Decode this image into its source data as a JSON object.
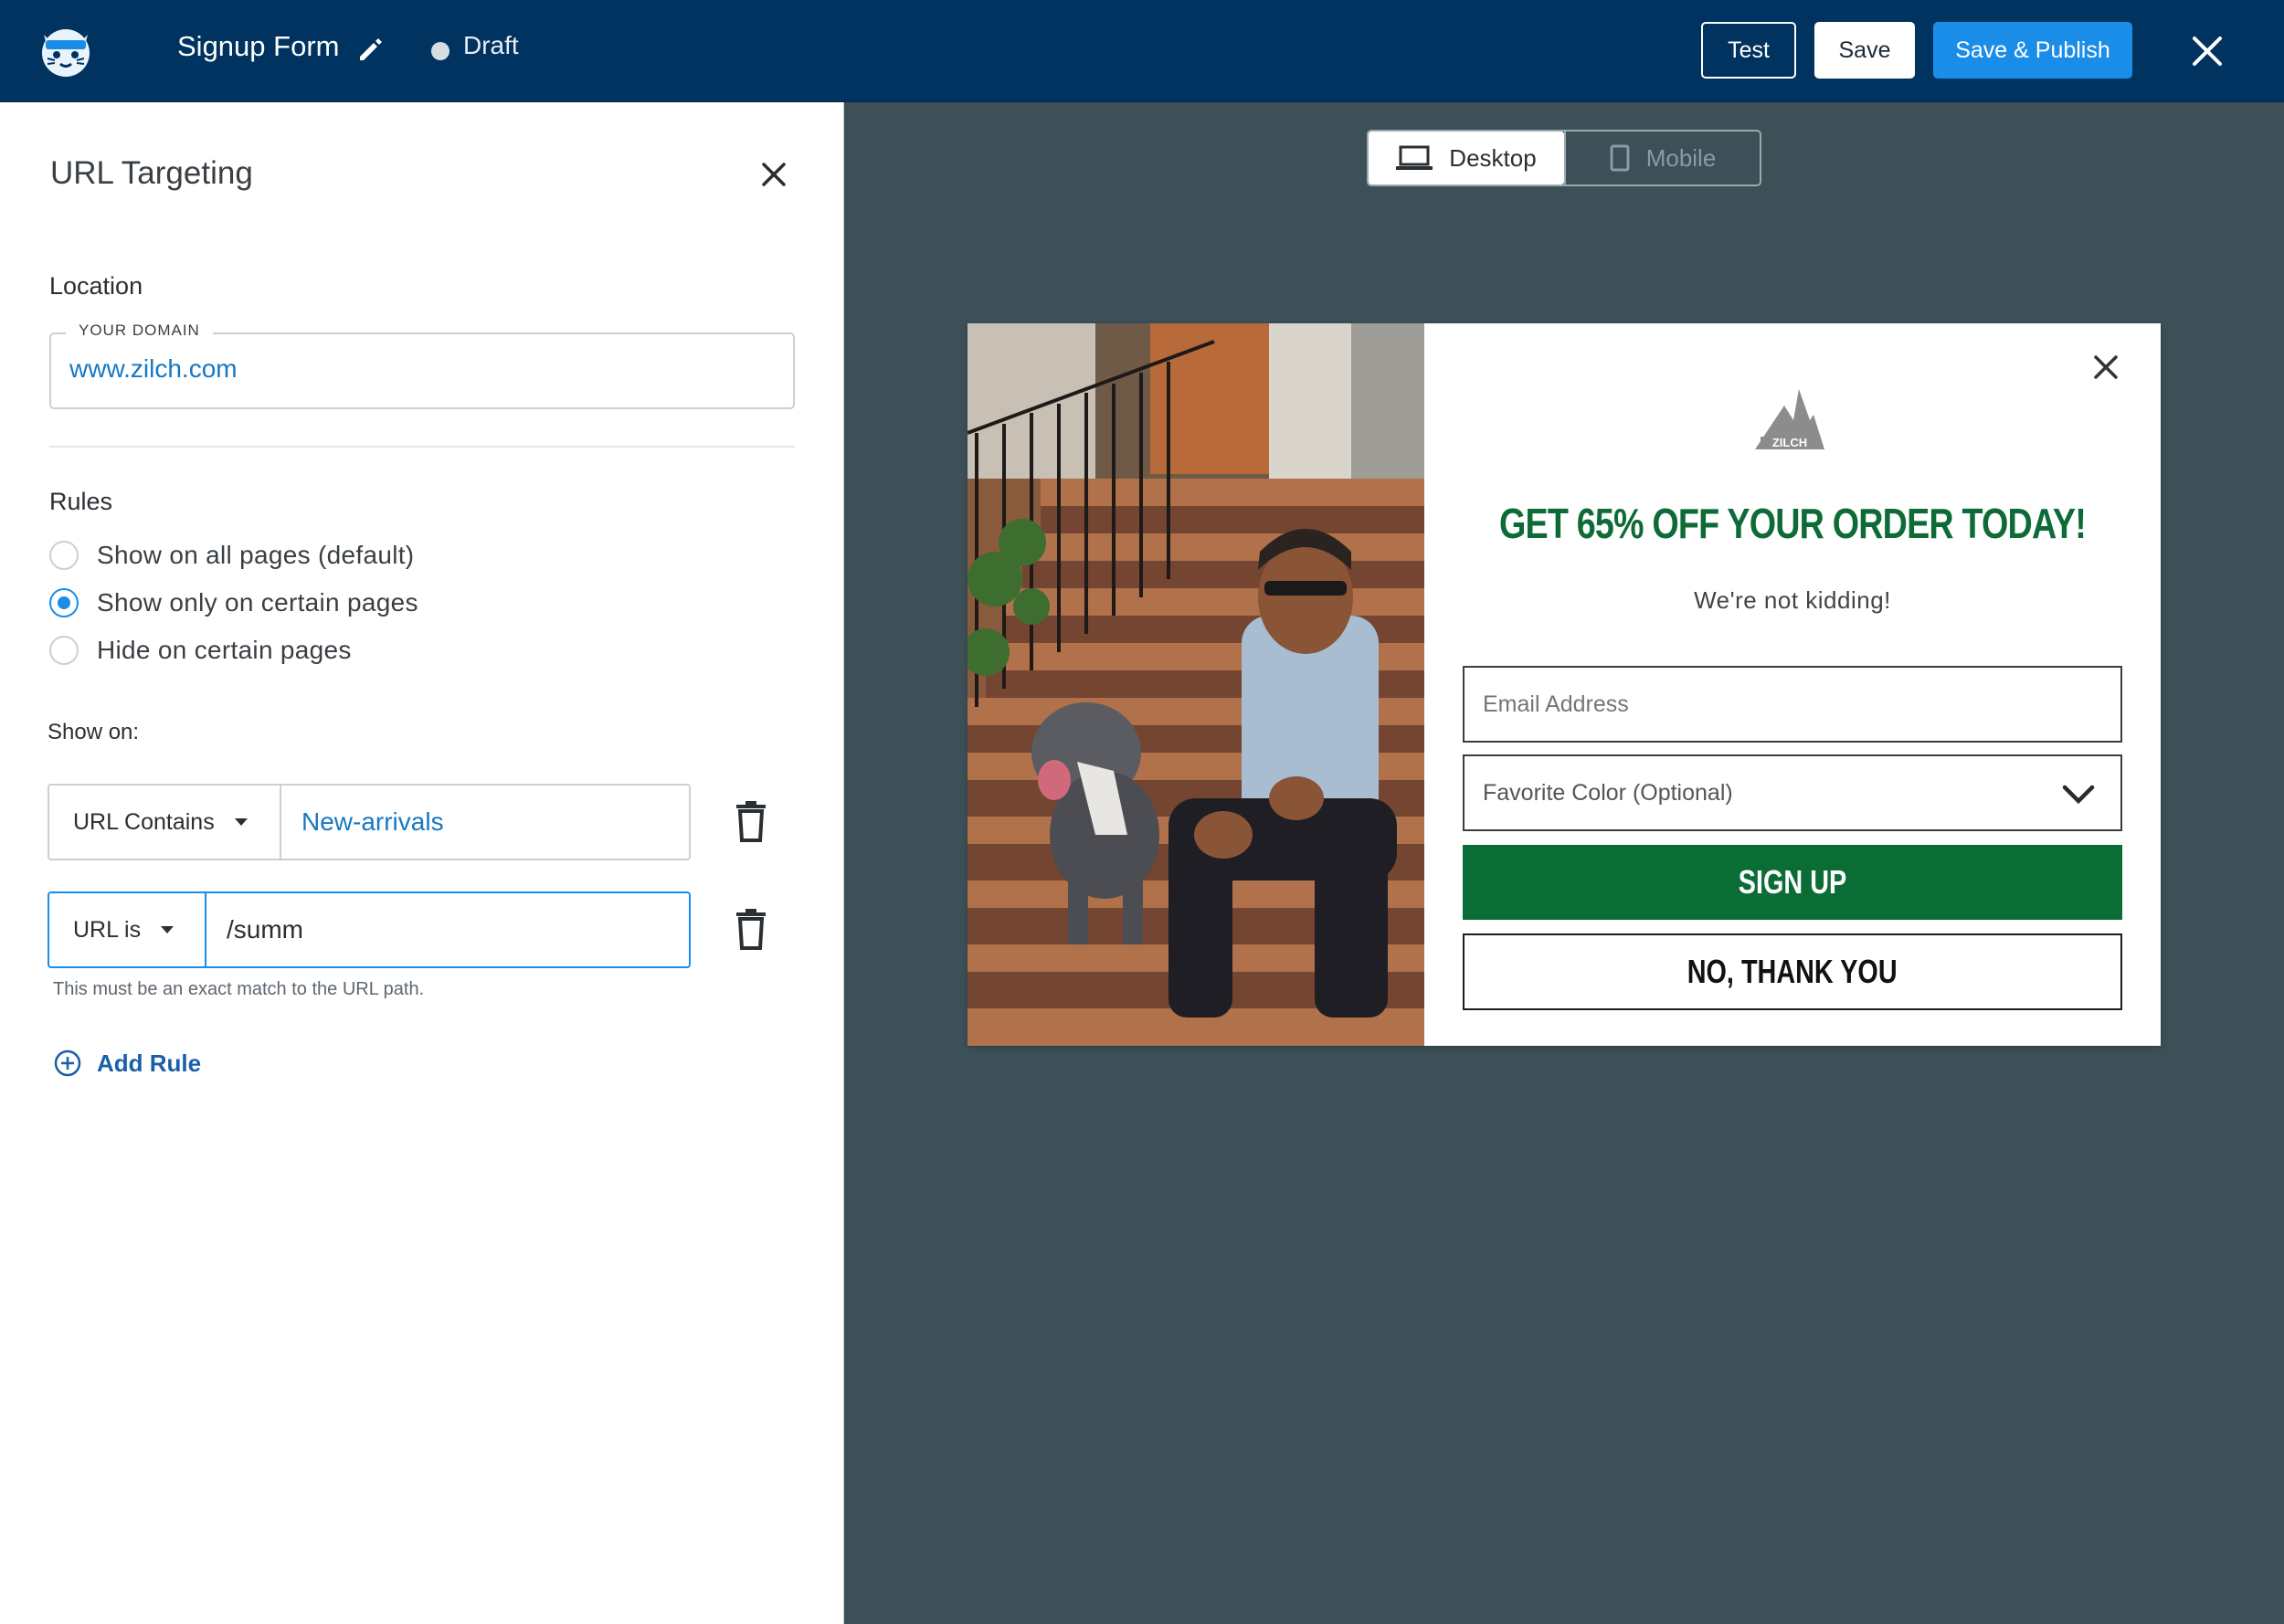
{
  "topbar": {
    "logo_icon": "tiger-mascot-logo",
    "form_title": "Signup Form",
    "edit_icon": "pencil-icon",
    "status": "Draft",
    "test_label": "Test",
    "save_label": "Save",
    "publish_label": "Save & Publish",
    "close_icon": "close-icon",
    "bg_color": "#00335f",
    "accent_color": "#1a8de8"
  },
  "panel": {
    "title": "URL Targeting",
    "location_label": "Location",
    "domain_legend": "YOUR DOMAIN",
    "domain_value": "www.zilch.com",
    "rules_label": "Rules",
    "rules_options": [
      {
        "label": "Show on all pages (default)",
        "checked": false
      },
      {
        "label": "Show only on certain pages",
        "checked": true
      },
      {
        "label": "Hide on certain pages",
        "checked": false
      }
    ],
    "show_on_label": "Show on:",
    "rule_rows": [
      {
        "condition": "URL Contains",
        "value": "New-arrivals"
      },
      {
        "condition": "URL is",
        "value": "/summ"
      }
    ],
    "hint": "This must be an exact match to the URL path.",
    "add_rule_label": "Add Rule"
  },
  "view_toggle": {
    "desktop_label": "Desktop",
    "mobile_label": "Mobile",
    "selected": "Desktop"
  },
  "popup": {
    "brand_logo_text": "ZILCH",
    "headline": "GET 65% OFF YOUR ORDER TODAY!",
    "subhead": "We're not kidding!",
    "email_placeholder": "Email Address",
    "color_select": "Favorite Color (Optional)",
    "signup_label": "SIGN UP",
    "decline_label": "NO, THANK YOU",
    "brand_color": "#0b6d36"
  }
}
